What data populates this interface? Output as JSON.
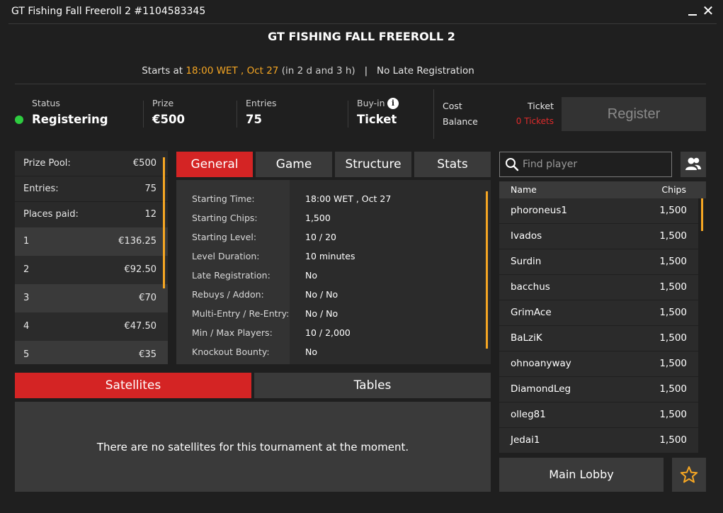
{
  "window": {
    "title": "GT Fishing Fall Freeroll 2 #1104583345"
  },
  "tournament": {
    "heading": "GT FISHING FALL FREEROLL 2",
    "starts_prefix": "Starts at",
    "start_time": "18:00 WET , Oct 27",
    "relative_time": "(in 2 d and 3 h)",
    "separator": "|",
    "late_reg": "No Late Registration"
  },
  "info": {
    "status_label": "Status",
    "status_value": "Registering",
    "prize_label": "Prize",
    "prize_value": "€500",
    "entries_label": "Entries",
    "entries_value": "75",
    "buyin_label": "Buy-in",
    "buyin_value": "Ticket",
    "info_glyph": "i",
    "cost_label": "Cost",
    "balance_label": "Balance",
    "ticket_label": "Ticket",
    "tickets_count": "0 Tickets",
    "register_label": "Register"
  },
  "prize_pool": {
    "summary": [
      {
        "label": "Prize Pool:",
        "value": "€500"
      },
      {
        "label": "Entries:",
        "value": "75"
      },
      {
        "label": "Places paid:",
        "value": "12"
      }
    ],
    "places": [
      {
        "place": "1",
        "amount": "€136.25"
      },
      {
        "place": "2",
        "amount": "€92.50"
      },
      {
        "place": "3",
        "amount": "€70"
      },
      {
        "place": "4",
        "amount": "€47.50"
      },
      {
        "place": "5",
        "amount": "€35"
      }
    ]
  },
  "tabs": [
    {
      "label": "General",
      "active": true
    },
    {
      "label": "Game",
      "active": false
    },
    {
      "label": "Structure",
      "active": false
    },
    {
      "label": "Stats",
      "active": false
    }
  ],
  "general": [
    {
      "label": "Starting Time:",
      "value": "18:00 WET , Oct 27"
    },
    {
      "label": "Starting Chips:",
      "value": "1,500"
    },
    {
      "label": "Starting Level:",
      "value": "10 / 20"
    },
    {
      "label": "Level Duration:",
      "value": "10 minutes"
    },
    {
      "label": "Late Registration:",
      "value": "No"
    },
    {
      "label": "Rebuys / Addon:",
      "value": "No / No"
    },
    {
      "label": "Multi-Entry / Re-Entry:",
      "value": "No / No"
    },
    {
      "label": "Min / Max Players:",
      "value": "10 / 2,000"
    },
    {
      "label": "Knockout Bounty:",
      "value": "No"
    }
  ],
  "bottom_tabs": [
    {
      "label": "Satellites",
      "active": true
    },
    {
      "label": "Tables",
      "active": false
    }
  ],
  "satellites": {
    "empty_message": "There are no satellites for this tournament at the moment."
  },
  "players": {
    "search_placeholder": "Find player",
    "name_header": "Name",
    "chips_header": "Chips",
    "rows": [
      {
        "name": "phoroneus1",
        "chips": "1,500"
      },
      {
        "name": "Ivados",
        "chips": "1,500"
      },
      {
        "name": "Surdin",
        "chips": "1,500"
      },
      {
        "name": "bacchus",
        "chips": "1,500"
      },
      {
        "name": "GrimAce",
        "chips": "1,500"
      },
      {
        "name": "BaLziK",
        "chips": "1,500"
      },
      {
        "name": "ohnoanyway",
        "chips": "1,500"
      },
      {
        "name": "DiamondLeg",
        "chips": "1,500"
      },
      {
        "name": "olleg81",
        "chips": "1,500"
      },
      {
        "name": "Jedai1",
        "chips": "1,500"
      }
    ]
  },
  "footer": {
    "main_lobby_label": "Main Lobby"
  },
  "colors": {
    "accent_red": "#d42424",
    "highlight_orange": "#f5a623",
    "status_green": "#2ecc40",
    "tickets_red": "#e02b2b"
  }
}
